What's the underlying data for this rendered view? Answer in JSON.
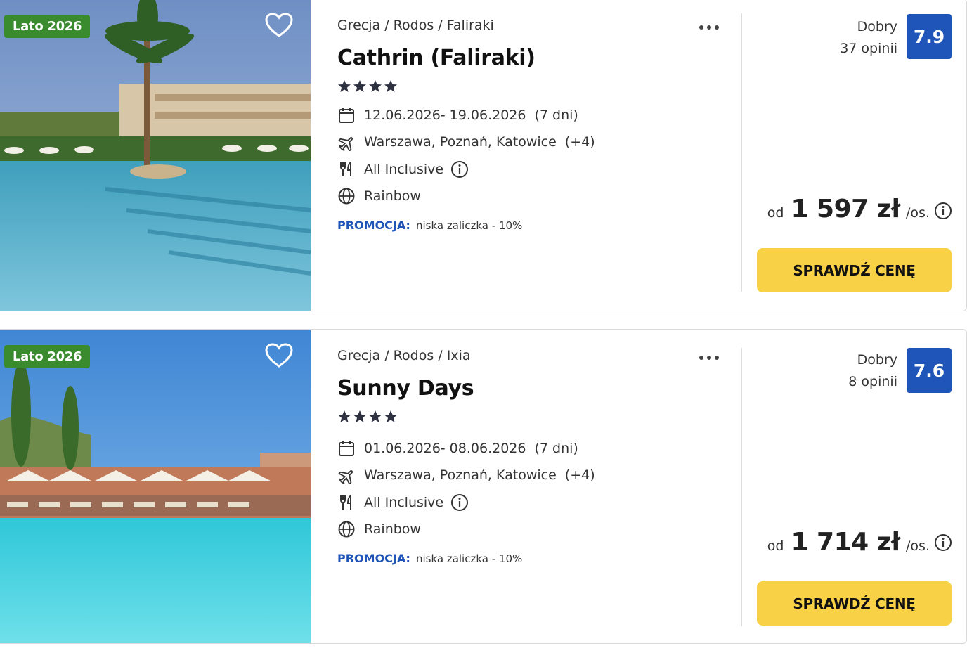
{
  "icons": {
    "favorite": "heart-outline-icon",
    "more": "more-dots-icon",
    "calendar": "calendar-icon",
    "flight": "airplane-icon",
    "board": "fork-knife-icon",
    "info": "info-circle-icon",
    "operator": "globe-icon",
    "star": "star-icon"
  },
  "colors": {
    "season_badge": "#3a8a2e",
    "rating_badge": "#1f55b8",
    "promo_label": "#1f55b8",
    "cta_button": "#f8d146"
  },
  "offers": [
    {
      "season_badge": "Lato 2026",
      "breadcrumb": [
        "Grecja",
        "Rodos",
        "Faliraki"
      ],
      "name": "Cathrin (Faliraki)",
      "stars": 4,
      "dates": "12.06.2026- 19.06.2026",
      "duration": "(7 dni)",
      "departures": "Warszawa, Poznań, Katowice",
      "departures_more": "(+4)",
      "board": "All Inclusive",
      "operator": "Rainbow",
      "promo_label": "PROMOCJA:",
      "promo_text": "niska zaliczka - 10%",
      "rating_label": "Dobry",
      "reviews": "37 opinii",
      "rating_score": "7.9",
      "price_from": "od",
      "price": "1 597 zł",
      "price_unit": "/os.",
      "cta": "SPRAWDŹ CENĘ"
    },
    {
      "season_badge": "Lato 2026",
      "breadcrumb": [
        "Grecja",
        "Rodos",
        "Ixia"
      ],
      "name": "Sunny Days",
      "stars": 4,
      "dates": "01.06.2026- 08.06.2026",
      "duration": "(7 dni)",
      "departures": "Warszawa, Poznań, Katowice",
      "departures_more": "(+4)",
      "board": "All Inclusive",
      "operator": "Rainbow",
      "promo_label": "PROMOCJA:",
      "promo_text": "niska zaliczka - 10%",
      "rating_label": "Dobry",
      "reviews": "8 opinii",
      "rating_score": "7.6",
      "price_from": "od",
      "price": "1 714 zł",
      "price_unit": "/os.",
      "cta": "SPRAWDŹ CENĘ"
    }
  ]
}
